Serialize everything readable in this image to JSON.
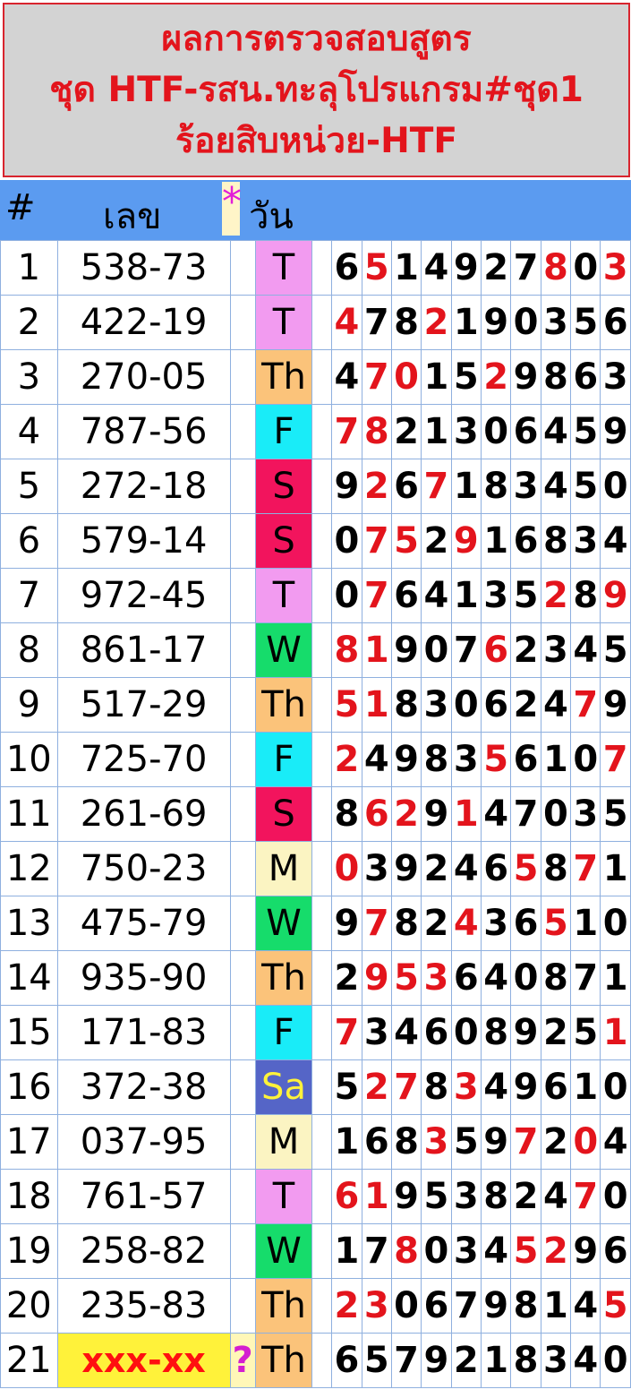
{
  "title": {
    "line1": "ผลการตรวจสอบสูตร",
    "line2": "ชุด HTF-รสน.ทะลุโปรแกรม#ชุด1",
    "line3": "ร้อยสิบหน่วย-HTF"
  },
  "header": {
    "num": "#",
    "number": "เลข",
    "mark": "*",
    "day": "วัน"
  },
  "colors": {
    "T": "#f29bf0",
    "Th": "#fbc37a",
    "F": "#19ecf8",
    "S": "#f2145d",
    "W": "#16dc6b",
    "M": "#fbf4c2",
    "Sa": "#5565c7",
    "title_red": "#e3141c"
  },
  "rows": [
    {
      "num": "1",
      "number": "538-73",
      "mark": "",
      "day": "T",
      "digits": [
        "6",
        "5",
        "1",
        "4",
        "9",
        "2",
        "7",
        "8",
        "0",
        "3"
      ],
      "red": [
        1,
        7,
        9
      ]
    },
    {
      "num": "2",
      "number": "422-19",
      "mark": "",
      "day": "T",
      "digits": [
        "4",
        "7",
        "8",
        "2",
        "1",
        "9",
        "0",
        "3",
        "5",
        "6"
      ],
      "red": [
        0,
        3
      ]
    },
    {
      "num": "3",
      "number": "270-05",
      "mark": "",
      "day": "Th",
      "digits": [
        "4",
        "7",
        "0",
        "1",
        "5",
        "2",
        "9",
        "8",
        "6",
        "3"
      ],
      "red": [
        1,
        2,
        5
      ]
    },
    {
      "num": "4",
      "number": "787-56",
      "mark": "",
      "day": "F",
      "digits": [
        "7",
        "8",
        "2",
        "1",
        "3",
        "0",
        "6",
        "4",
        "5",
        "9"
      ],
      "red": [
        0,
        1
      ]
    },
    {
      "num": "5",
      "number": "272-18",
      "mark": "",
      "day": "S",
      "digits": [
        "9",
        "2",
        "6",
        "7",
        "1",
        "8",
        "3",
        "4",
        "5",
        "0"
      ],
      "red": [
        1,
        3
      ]
    },
    {
      "num": "6",
      "number": "579-14",
      "mark": "",
      "day": "S",
      "digits": [
        "0",
        "7",
        "5",
        "2",
        "9",
        "1",
        "6",
        "8",
        "3",
        "4"
      ],
      "red": [
        1,
        2,
        4
      ]
    },
    {
      "num": "7",
      "number": "972-45",
      "mark": "",
      "day": "T",
      "digits": [
        "0",
        "7",
        "6",
        "4",
        "1",
        "3",
        "5",
        "2",
        "8",
        "9"
      ],
      "red": [
        1,
        7,
        9
      ]
    },
    {
      "num": "8",
      "number": "861-17",
      "mark": "",
      "day": "W",
      "digits": [
        "8",
        "1",
        "9",
        "0",
        "7",
        "6",
        "2",
        "3",
        "4",
        "5"
      ],
      "red": [
        0,
        1,
        5
      ]
    },
    {
      "num": "9",
      "number": "517-29",
      "mark": "",
      "day": "Th",
      "digits": [
        "5",
        "1",
        "8",
        "3",
        "0",
        "6",
        "2",
        "4",
        "7",
        "9"
      ],
      "red": [
        0,
        1,
        8
      ]
    },
    {
      "num": "10",
      "number": "725-70",
      "mark": "",
      "day": "F",
      "digits": [
        "2",
        "4",
        "9",
        "8",
        "3",
        "5",
        "6",
        "1",
        "0",
        "7"
      ],
      "red": [
        0,
        5,
        9
      ]
    },
    {
      "num": "11",
      "number": "261-69",
      "mark": "",
      "day": "S",
      "digits": [
        "8",
        "6",
        "2",
        "9",
        "1",
        "4",
        "7",
        "0",
        "3",
        "5"
      ],
      "red": [
        1,
        2,
        4
      ]
    },
    {
      "num": "12",
      "number": "750-23",
      "mark": "",
      "day": "M",
      "digits": [
        "0",
        "3",
        "9",
        "2",
        "4",
        "6",
        "5",
        "8",
        "7",
        "1"
      ],
      "red": [
        0,
        6,
        8
      ]
    },
    {
      "num": "13",
      "number": "475-79",
      "mark": "",
      "day": "W",
      "digits": [
        "9",
        "7",
        "8",
        "2",
        "4",
        "3",
        "6",
        "5",
        "1",
        "0"
      ],
      "red": [
        1,
        4,
        7
      ]
    },
    {
      "num": "14",
      "number": "935-90",
      "mark": "",
      "day": "Th",
      "digits": [
        "2",
        "9",
        "5",
        "3",
        "6",
        "4",
        "0",
        "8",
        "7",
        "1"
      ],
      "red": [
        1,
        2,
        3
      ]
    },
    {
      "num": "15",
      "number": "171-83",
      "mark": "",
      "day": "F",
      "digits": [
        "7",
        "3",
        "4",
        "6",
        "0",
        "8",
        "9",
        "2",
        "5",
        "1"
      ],
      "red": [
        0,
        9
      ]
    },
    {
      "num": "16",
      "number": "372-38",
      "mark": "",
      "day": "Sa",
      "digits": [
        "5",
        "2",
        "7",
        "8",
        "3",
        "4",
        "9",
        "6",
        "1",
        "0"
      ],
      "red": [
        1,
        2,
        4
      ]
    },
    {
      "num": "17",
      "number": "037-95",
      "mark": "",
      "day": "M",
      "digits": [
        "1",
        "6",
        "8",
        "3",
        "5",
        "9",
        "7",
        "2",
        "0",
        "4"
      ],
      "red": [
        3,
        6,
        8
      ]
    },
    {
      "num": "18",
      "number": "761-57",
      "mark": "",
      "day": "T",
      "digits": [
        "6",
        "1",
        "9",
        "5",
        "3",
        "8",
        "2",
        "4",
        "7",
        "0"
      ],
      "red": [
        0,
        1,
        8
      ]
    },
    {
      "num": "19",
      "number": "258-82",
      "mark": "",
      "day": "W",
      "digits": [
        "1",
        "7",
        "8",
        "0",
        "3",
        "4",
        "5",
        "2",
        "9",
        "6"
      ],
      "red": [
        2,
        6,
        7
      ]
    },
    {
      "num": "20",
      "number": "235-83",
      "mark": "",
      "day": "Th",
      "digits": [
        "2",
        "3",
        "0",
        "6",
        "7",
        "9",
        "8",
        "1",
        "4",
        "5"
      ],
      "red": [
        0,
        1,
        9
      ]
    },
    {
      "num": "21",
      "number": "xxx-xx",
      "mark": "?",
      "day": "Th",
      "digits": [
        "6",
        "5",
        "7",
        "9",
        "2",
        "1",
        "8",
        "3",
        "4",
        "0"
      ],
      "red": []
    }
  ]
}
